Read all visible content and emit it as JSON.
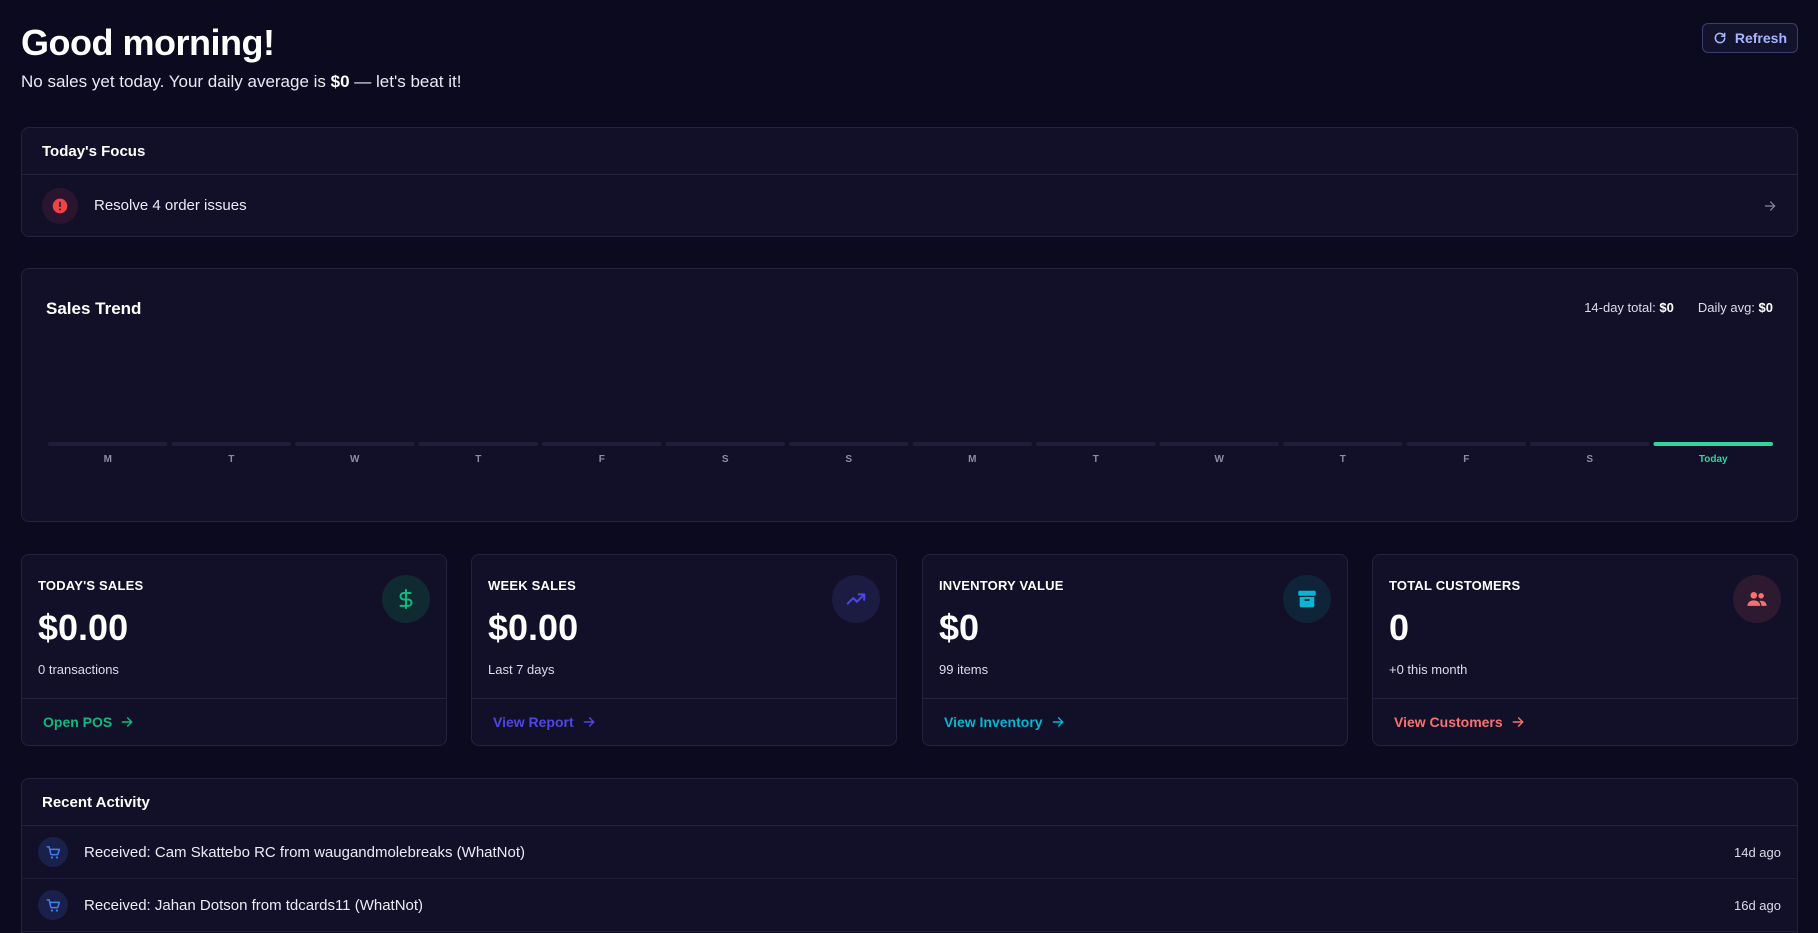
{
  "header": {
    "greeting": "Good morning!",
    "subtitle_prefix": "No sales yet today. Your daily average is ",
    "subtitle_amount": "$0",
    "subtitle_suffix": " — let's beat it!",
    "refresh_label": "Refresh"
  },
  "focus": {
    "title": "Today's Focus",
    "items": [
      {
        "label": "Resolve 4 order issues",
        "icon": "alert-circle-icon"
      }
    ]
  },
  "trend": {
    "title": "Sales Trend",
    "total_label": "14-day total:",
    "total_value": "$0",
    "avg_label": "Daily avg:",
    "avg_value": "$0"
  },
  "chart_data": {
    "type": "bar",
    "title": "Sales Trend",
    "categories": [
      "M",
      "T",
      "W",
      "T",
      "F",
      "S",
      "S",
      "M",
      "T",
      "W",
      "T",
      "F",
      "S",
      "Today"
    ],
    "values": [
      0,
      0,
      0,
      0,
      0,
      0,
      0,
      0,
      0,
      0,
      0,
      0,
      0,
      0
    ],
    "highlight_index": 13,
    "highlight_color": "#34d399",
    "bar_color": "#1f1d3a",
    "grid": false
  },
  "stats": [
    {
      "label": "TODAY'S SALES",
      "value": "$0.00",
      "sub": "0 transactions",
      "link": "Open POS",
      "icon": "dollar-icon",
      "accent": "#10b981",
      "icon_bg": "#0f2a30"
    },
    {
      "label": "WEEK SALES",
      "value": "$0.00",
      "sub": "Last 7 days",
      "link": "View Report",
      "icon": "trending-up-icon",
      "accent": "#4f46e5",
      "icon_bg": "#1c1b42"
    },
    {
      "label": "INVENTORY VALUE",
      "value": "$0",
      "sub": "99 items",
      "link": "View Inventory",
      "icon": "archive-icon",
      "accent": "#06b6d4",
      "icon_bg": "#0f2438"
    },
    {
      "label": "TOTAL CUSTOMERS",
      "value": "0",
      "sub": "+0 this month",
      "link": "View Customers",
      "icon": "users-icon",
      "accent": "#f87171",
      "icon_bg": "#2e1a30"
    }
  ],
  "activity": {
    "title": "Recent Activity",
    "items": [
      {
        "text": "Received: Cam Skattebo RC from waugandmolebreaks (WhatNot)",
        "time": "14d ago",
        "icon": "cart-icon"
      },
      {
        "text": "Received: Jahan Dotson from tdcards11 (WhatNot)",
        "time": "16d ago",
        "icon": "cart-icon"
      }
    ]
  }
}
